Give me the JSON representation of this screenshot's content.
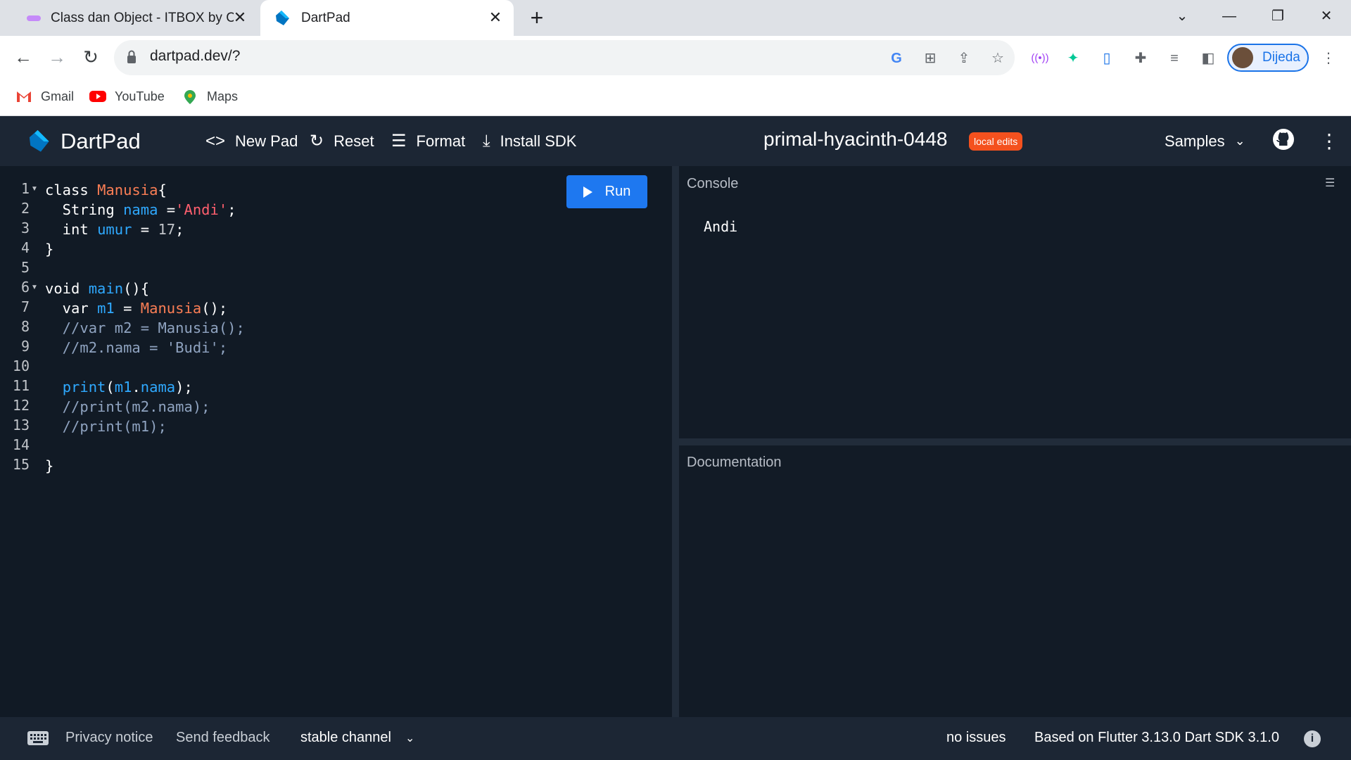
{
  "browser": {
    "tabs": [
      {
        "title": "Class dan Object - ITBOX by Cou",
        "close": "✕"
      },
      {
        "title": "DartPad",
        "close": "✕"
      }
    ],
    "new_tab": "+",
    "url": "dartpad.dev/?",
    "profile_name": "Dijeda",
    "bookmarks": [
      "Gmail",
      "YouTube",
      "Maps"
    ]
  },
  "header": {
    "app_name": "DartPad",
    "new_pad": "New Pad",
    "reset": "Reset",
    "format": "Format",
    "install_sdk": "Install SDK",
    "pad_name": "primal-hyacinth-0448",
    "badge": "local edits",
    "samples": "Samples"
  },
  "editor": {
    "run_label": "Run",
    "line_numbers": [
      "1",
      "2",
      "3",
      "4",
      "5",
      "6",
      "7",
      "8",
      "9",
      "10",
      "11",
      "12",
      "13",
      "14",
      "15"
    ]
  },
  "console": {
    "title": "Console",
    "output": "Andi"
  },
  "docs": {
    "title": "Documentation"
  },
  "footer": {
    "privacy": "Privacy notice",
    "feedback": "Send feedback",
    "channel": "stable channel",
    "issues": "no issues",
    "version": "Based on Flutter 3.13.0 Dart SDK 3.1.0"
  },
  "colors": {
    "run_button": "#1e78f0",
    "badge": "#f4511e",
    "header_bg": "#1c2634",
    "editor_bg": "#111a25"
  }
}
